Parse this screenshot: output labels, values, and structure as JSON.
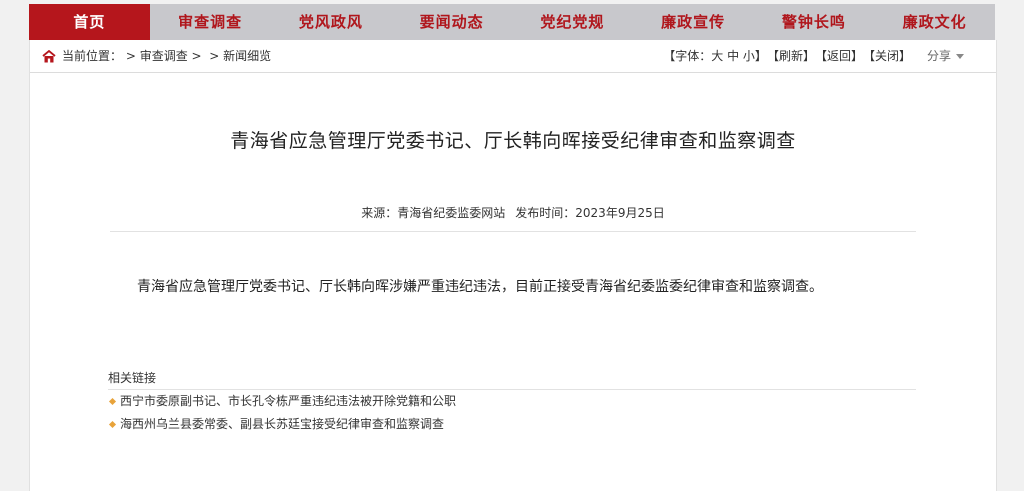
{
  "nav": {
    "items": [
      {
        "label": "首页",
        "active": true
      },
      {
        "label": "审查调查"
      },
      {
        "label": "党风政风"
      },
      {
        "label": "要闻动态"
      },
      {
        "label": "党纪党规"
      },
      {
        "label": "廉政宣传"
      },
      {
        "label": "警钟长鸣"
      },
      {
        "label": "廉政文化"
      }
    ]
  },
  "breadcrumb": {
    "icon": "home-icon",
    "prefix": "当前位置：",
    "sep1": " > ",
    "item1": "审查调查",
    "sep2": " > ",
    "sep3": " > ",
    "item2": "新闻细览"
  },
  "tools": {
    "font_label": "【字体：",
    "font_large": "大",
    "font_medium": "中",
    "font_small": "小",
    "font_close": "】",
    "refresh": "【刷新】",
    "back": "【返回】",
    "close": "【关闭】",
    "share": "分享"
  },
  "article": {
    "title": "青海省应急管理厅党委书记、厅长韩向晖接受纪律审查和监察调查",
    "source": "来源：青海省纪委监委网站",
    "publish_time": "发布时间：2023年9月25日",
    "body": "青海省应急管理厅党委书记、厅长韩向晖涉嫌严重违纪违法，目前正接受青海省纪委监委纪律审查和监察调查。"
  },
  "related": {
    "title": "相关链接",
    "items": [
      "西宁市委原副书记、市长孔令栋严重违纪违法被开除党籍和公职",
      "海西州乌兰县委常委、副县长苏廷宝接受纪律审查和监察调查"
    ]
  },
  "colors": {
    "brand_red": "#b5161c",
    "nav_bg": "#c8c8cc",
    "bullet": "#e8a33a"
  }
}
